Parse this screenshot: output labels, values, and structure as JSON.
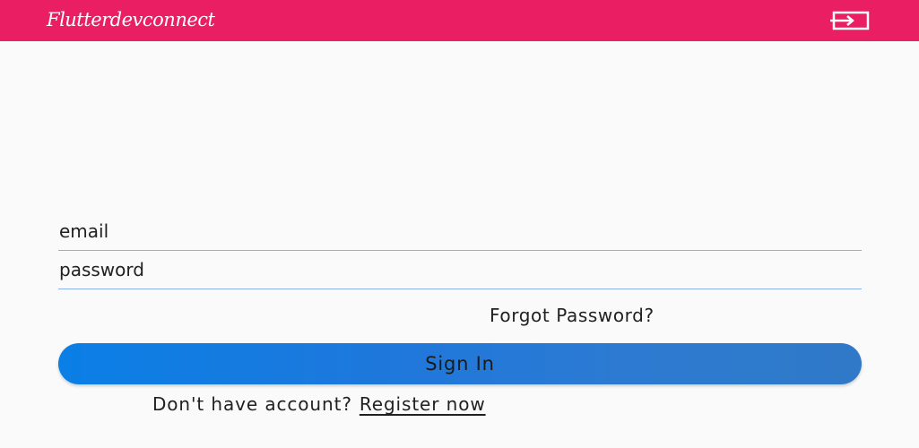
{
  "appbar": {
    "title": "Flutterdevconnect",
    "background": "#e91e63",
    "logout_icon": "logout-icon"
  },
  "form": {
    "email_placeholder": "email",
    "password_placeholder": "password",
    "forgot_label": "Forgot Password?",
    "signin_label": "Sign In",
    "no_account_text": "Don't have account?",
    "register_label": "Register now",
    "accent": "#1e78dc"
  }
}
